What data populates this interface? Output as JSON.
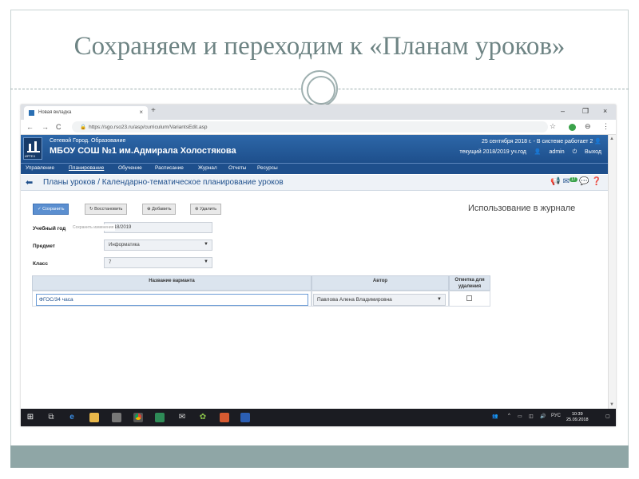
{
  "slide": {
    "title": "Сохраняем и переходим к «Планам уроков»"
  },
  "browser": {
    "tab_label": "Новая вкладка",
    "tab_close": "×",
    "new_tab": "+",
    "win_min": "–",
    "win_max": "❐",
    "win_close": "×",
    "back": "←",
    "forward": "→",
    "reload": "C",
    "url": "https://sgo.rso23.ru/asp/curriculum/VariantsEdit.asp",
    "star": "☆",
    "account": "⊖",
    "menu": "⋮"
  },
  "app": {
    "brand": "Сетевой Город. Образование",
    "school": "МБОУ СОШ №1 им.Адмирала Холостякова",
    "logo_caption": "ИРТЕХ",
    "date_info": "25 сентября 2018 г. - В системе работает 2",
    "year_info": "текущий 2018/2019 уч.год",
    "user": "admin",
    "logout": "Выход",
    "menu": [
      "Управление",
      "Планирование",
      "Обучение",
      "Расписание",
      "Журнал",
      "Отчеты",
      "Ресурсы"
    ],
    "page_title": "Планы уроков / Календарно-тематическое планирование уроков",
    "badge_count": "17"
  },
  "toolbar": {
    "save": "Сохранить",
    "restore": "Восстановить",
    "add": "Добавить",
    "delete": "Удалить"
  },
  "journal_use": "Использование в журнале",
  "form": {
    "year_label": "Учебный год",
    "year_value": "2018/2019",
    "tooltip": "Сохранить изменения",
    "subject_label": "Предмет",
    "subject_value": "Информатика",
    "class_label": "Класс",
    "class_value": "7"
  },
  "grid": {
    "headers": [
      "Название варианта",
      "Автор",
      "Отметка для удаления"
    ],
    "row": {
      "variant": "ФГОС/34 часа",
      "author": "Павлова Алена Владимировна"
    }
  },
  "taskbar": {
    "lang": "РУС",
    "time": "10:39",
    "date": "25.09.2018"
  }
}
